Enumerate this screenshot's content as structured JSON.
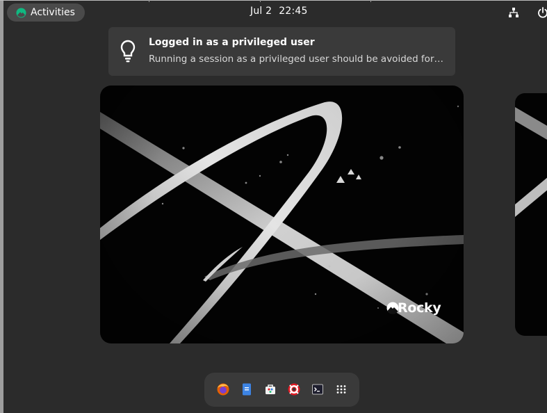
{
  "topbar": {
    "activities_label": "Activities",
    "date": "Jul 2",
    "time": "22:45"
  },
  "notification": {
    "title": "Logged in as a privileged user",
    "body": "Running a session as a privileged user should be avoided for sec…"
  },
  "wallpaper": {
    "brand_text": "Rocky"
  },
  "dash": {
    "items": [
      "firefox-icon",
      "files-icon",
      "software-icon",
      "help-icon",
      "terminal-icon",
      "app-grid-icon"
    ]
  },
  "colors": {
    "accent": "#10b981",
    "panel": "#3a3a3a",
    "background": "#2b2b2b"
  }
}
